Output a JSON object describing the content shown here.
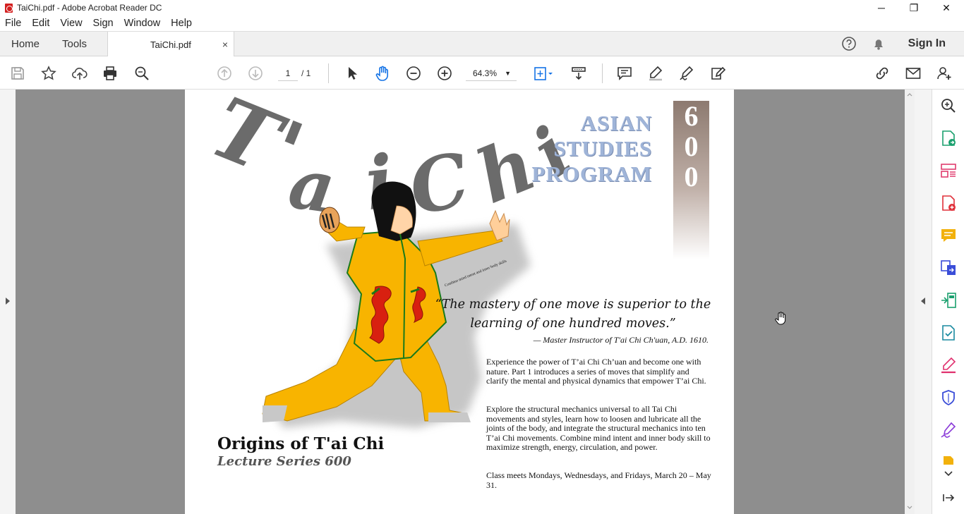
{
  "window": {
    "title": "TaiChi.pdf - Adobe Acrobat Reader DC",
    "controls": {
      "minimize": "─",
      "maximize": "❐",
      "close": "✕"
    }
  },
  "menu": [
    "File",
    "Edit",
    "View",
    "Sign",
    "Window",
    "Help"
  ],
  "tabs": {
    "home": "Home",
    "tools": "Tools",
    "document": "TaiChi.pdf",
    "close": "×"
  },
  "header": {
    "signin": "Sign In"
  },
  "toolbar": {
    "page_current": "1",
    "page_total": "/ 1",
    "zoom": "64.3%",
    "icons": [
      "save-icon",
      "star-icon",
      "upload-icon",
      "print-icon",
      "search-icon",
      "page-up-icon",
      "page-down-icon",
      "select-arrow-icon",
      "hand-icon",
      "zoom-out-icon",
      "zoom-in-icon",
      "fit-page-icon",
      "scroll-mode-icon",
      "comment-icon",
      "highlight-pen-icon",
      "sign-icon",
      "edit-icon",
      "link-icon",
      "email-icon",
      "add-user-icon"
    ]
  },
  "right_panel": {
    "icons": [
      "zoom-panel-icon",
      "export-pdf-icon",
      "organize-pages-icon",
      "create-pdf-icon",
      "comment-icon",
      "combine-files-icon",
      "compress-icon",
      "send-for-review-icon",
      "fill-sign-icon",
      "protect-icon",
      "request-signature-icon",
      "more-tools-icon"
    ]
  },
  "document": {
    "title_art": "T'ai Chi",
    "program": [
      "ASIAN",
      "STUDIES",
      "PROGRAM"
    ],
    "number_digits": [
      "6",
      "0",
      "0"
    ],
    "curved_caption": "Combine mind intent and inner body skills",
    "quote_line1": "“The mastery of one move is superior to the",
    "quote_line2": "learning of one hundred moves.”",
    "attribution": "— Master Instructor of T'ai Chi Ch'uan, A.D. 1610.",
    "paragraph1": "Experience the power of T’ai Chi Ch’uan and become one with nature. Part 1 introduces a series  of moves that simplify and clarify the mental and physical dynamics that empower T’ai Chi.",
    "paragraph2": " Explore the structural mechanics universal to all Tai Chi movements and styles, learn how to  loosen and lubricate all the joints of the body, and integrate the structural mechanics into ten T’ai  Chi movements. Combine mind intent and inner body skill to maximize strength, energy,  circulation, and power.",
    "paragraph3": "Class meets Mondays, Wednesdays, and Fridays, March 20 – May 31.",
    "heading": "Origins of T'ai Chi",
    "subheading": "Lecture Series 600"
  },
  "colors": {
    "accent_blue": "#1473e6",
    "pdf_red": "#d32020",
    "suit_yellow": "#f8b400",
    "trim_green": "#1a7a1a",
    "dragon_red": "#d82010",
    "program_blue": "#9fb4d8",
    "pane_gray": "#8e8e8e"
  }
}
